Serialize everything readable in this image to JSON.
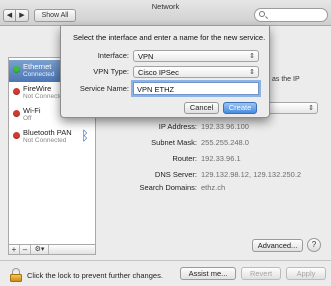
{
  "window": {
    "title": "Network",
    "show_all_label": "Show All",
    "back_glyph": "◀",
    "forward_glyph": "▶",
    "search_placeholder": ""
  },
  "sidebar": {
    "items": [
      {
        "name": "Ethernet",
        "status": "Connected",
        "status_color": "#3bbd3b",
        "selected": true
      },
      {
        "name": "FireWire",
        "status": "Not Connected",
        "status_color": "#d13a30"
      },
      {
        "name": "Wi-Fi",
        "status": "Off",
        "status_color": "#d13a30"
      },
      {
        "name": "Bluetooth PAN",
        "status": "Not Connected",
        "status_color": "#d13a30",
        "icon": "bluetooth-icon"
      }
    ],
    "tools": {
      "add": "+",
      "remove": "–",
      "action": "⚙▾"
    }
  },
  "detail": {
    "behind_text": "as the IP",
    "rows": [
      {
        "label": "IP Address:",
        "value": "192.33.96.100"
      },
      {
        "label": "Subnet Mask:",
        "value": "255.255.248.0"
      },
      {
        "label": "Router:",
        "value": "192.33.96.1"
      },
      {
        "label": "DNS Server:",
        "value": "129.132.98.12, 129.132.250.2"
      },
      {
        "label": "Search Domains:",
        "value": "ethz.ch"
      }
    ],
    "advanced_label": "Advanced...",
    "help_label": "?"
  },
  "bottom": {
    "lock_text": "Click the lock to prevent further changes.",
    "assist_label": "Assist me...",
    "revert_label": "Revert",
    "apply_label": "Apply"
  },
  "sheet": {
    "title": "Select the interface and enter a name for the new service.",
    "interface_label": "Interface:",
    "interface_value": "VPN",
    "vpn_type_label": "VPN Type:",
    "vpn_type_value": "Cisco IPSec",
    "service_name_label": "Service Name:",
    "service_name_value": "VPN ETHZ",
    "cancel_label": "Cancel",
    "create_label": "Create"
  },
  "colors": {
    "accent": "#4a8be0",
    "selection": "#4d77b5"
  }
}
